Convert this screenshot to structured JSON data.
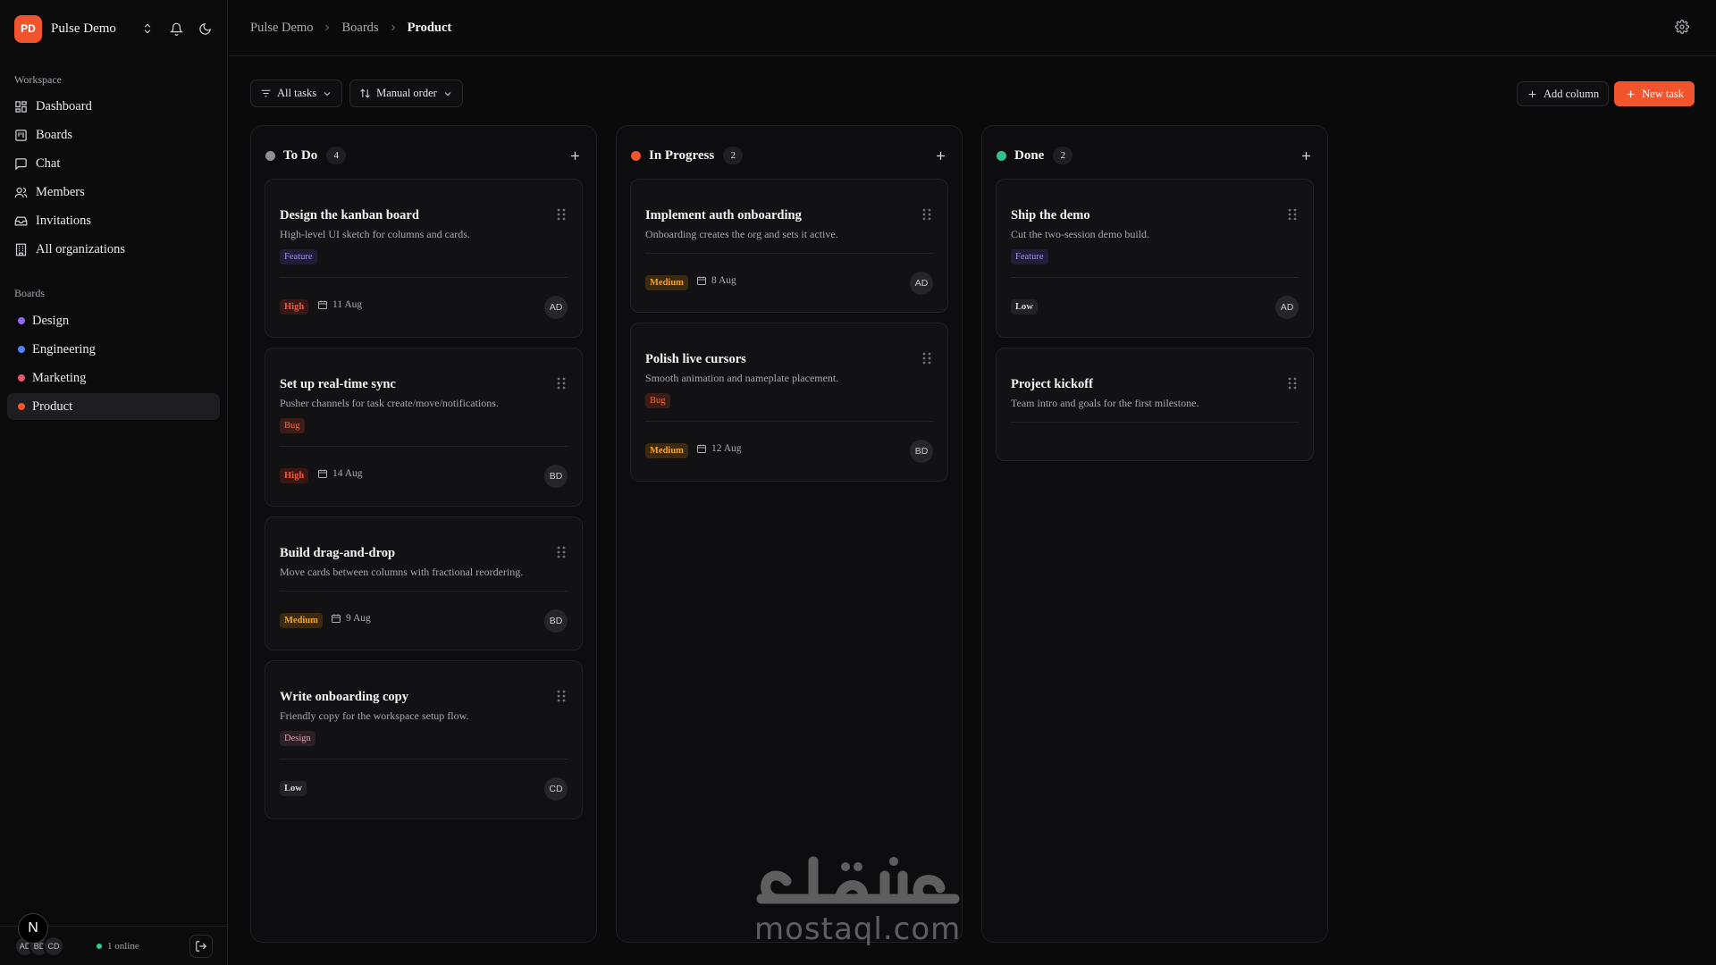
{
  "org": {
    "initials": "PD",
    "name": "Pulse Demo",
    "accent": "#f2542d"
  },
  "sidebar": {
    "workspace_label": "Workspace",
    "nav": [
      {
        "label": "Dashboard",
        "icon": "dashboard-icon"
      },
      {
        "label": "Boards",
        "icon": "boards-icon"
      },
      {
        "label": "Chat",
        "icon": "chat-icon"
      },
      {
        "label": "Members",
        "icon": "members-icon"
      },
      {
        "label": "Invitations",
        "icon": "inbox-icon"
      },
      {
        "label": "All organizations",
        "icon": "building-icon"
      }
    ],
    "boards_label": "Boards",
    "boards": [
      {
        "label": "Design",
        "color": "#8b6cf7"
      },
      {
        "label": "Engineering",
        "color": "#4f86f7"
      },
      {
        "label": "Marketing",
        "color": "#e05a6d"
      },
      {
        "label": "Product",
        "color": "#f2542d",
        "active": true
      }
    ],
    "footer": {
      "avatars": [
        "AD",
        "BD",
        "CD"
      ],
      "online": "1 online",
      "badge": "N"
    }
  },
  "breadcrumb": [
    "Pulse Demo",
    "Boards",
    "Product"
  ],
  "toolbar": {
    "filter_label": "All tasks",
    "sort_label": "Manual order",
    "add_column_label": "Add column",
    "new_task_label": "New task"
  },
  "columns": [
    {
      "title": "To Do",
      "count": "4",
      "color": "#8e8e94",
      "cards": [
        {
          "title": "Design the kanban board",
          "desc": "High-level UI sketch for columns and cards.",
          "tag": "Feature",
          "tag_kind": "feature",
          "priority": "High",
          "prio_kind": "high",
          "due": "11 Aug",
          "assignee": "AD"
        },
        {
          "title": "Set up real-time sync",
          "desc": "Pusher channels for task create/move/notifications.",
          "tag": "Bug",
          "tag_kind": "bug",
          "priority": "High",
          "prio_kind": "high",
          "due": "14 Aug",
          "assignee": "BD"
        },
        {
          "title": "Build drag-and-drop",
          "desc": "Move cards between columns with fractional reordering.",
          "tag": "",
          "tag_kind": "",
          "priority": "Medium",
          "prio_kind": "medium",
          "due": "9 Aug",
          "assignee": "BD"
        },
        {
          "title": "Write onboarding copy",
          "desc": "Friendly copy for the workspace setup flow.",
          "tag": "Design",
          "tag_kind": "design",
          "priority": "Low",
          "prio_kind": "low",
          "due": "",
          "assignee": "CD"
        }
      ]
    },
    {
      "title": "In Progress",
      "count": "2",
      "color": "#f2542d",
      "cards": [
        {
          "title": "Implement auth onboarding",
          "desc": "Onboarding creates the org and sets it active.",
          "tag": "",
          "tag_kind": "",
          "priority": "Medium",
          "prio_kind": "medium",
          "due": "8 Aug",
          "assignee": "AD"
        },
        {
          "title": "Polish live cursors",
          "desc": "Smooth animation and nameplate placement.",
          "tag": "Bug",
          "tag_kind": "bug",
          "priority": "Medium",
          "prio_kind": "medium",
          "due": "12 Aug",
          "assignee": "BD"
        }
      ]
    },
    {
      "title": "Done",
      "count": "2",
      "color": "#2bc38a",
      "cards": [
        {
          "title": "Ship the demo",
          "desc": "Cut the two-session demo build.",
          "tag": "Feature",
          "tag_kind": "feature",
          "priority": "Low",
          "prio_kind": "low",
          "due": "",
          "assignee": "AD"
        },
        {
          "title": "Project kickoff",
          "desc": "Team intro and goals for the first milestone.",
          "tag": "",
          "tag_kind": "",
          "priority": "",
          "prio_kind": "",
          "due": "",
          "assignee": ""
        }
      ]
    }
  ],
  "watermark": {
    "arabic": "مستقل",
    "latin": "mostaql.com"
  }
}
